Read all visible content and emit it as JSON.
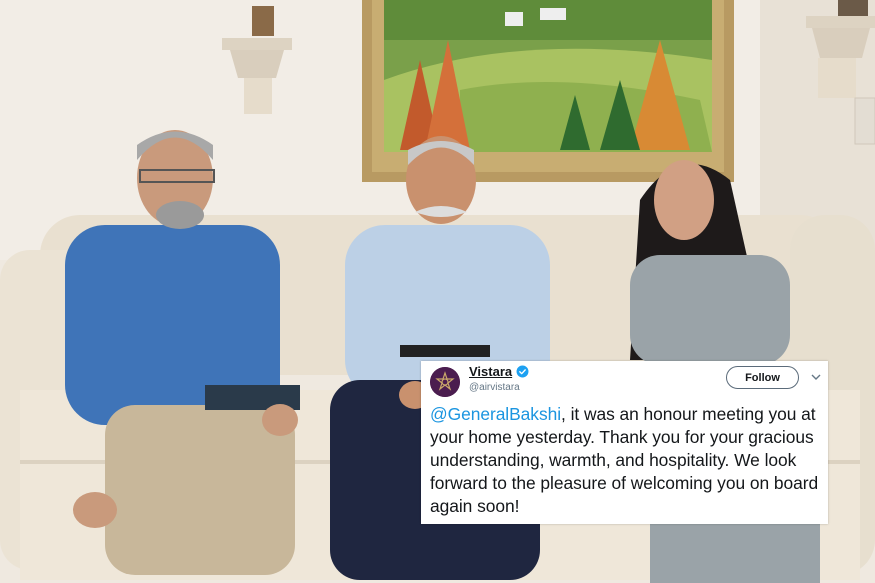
{
  "photo": {
    "description_icon": "photo-of-three-people-on-sofa"
  },
  "tweet": {
    "display_name": "Vistara",
    "handle": "@airvistara",
    "follow_label": "Follow",
    "mention": "@GeneralBakshi",
    "body": ", it was an honour meeting you at your home yesterday. Thank you for your gracious understanding, warmth, and hospitality. We look forward to the pleasure of welcoming you on board again soon!",
    "icons": {
      "avatar": "vistara-logo-icon",
      "verified": "verified-badge-icon",
      "menu": "chevron-down-icon"
    },
    "colors": {
      "mention": "#1b95e0",
      "verified": "#1da1f2",
      "avatar_bg": "#4b1d4f"
    }
  }
}
